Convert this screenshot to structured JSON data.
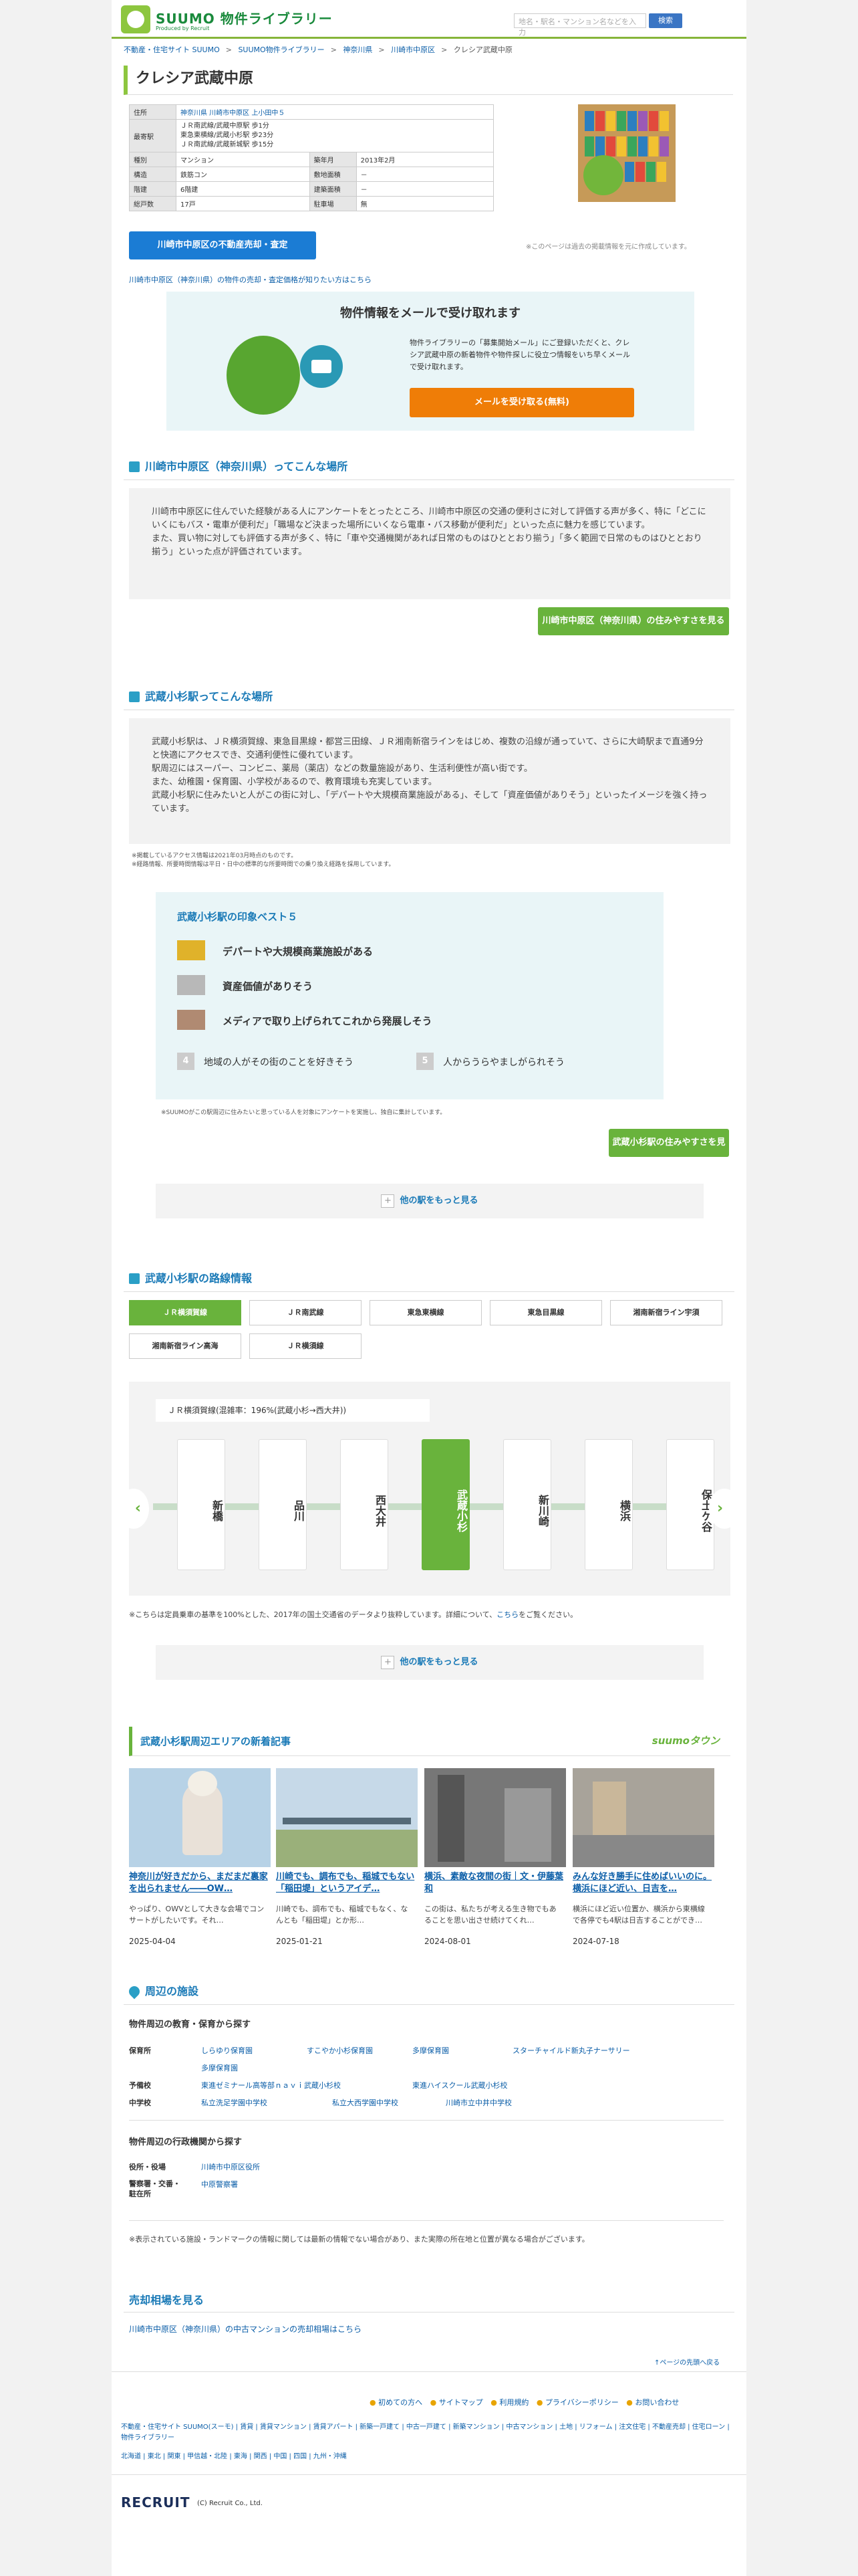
{
  "header": {
    "site_name": "SUUMO 物件ライブラリー",
    "logo_sub": "Produced by Recruit",
    "search_placeholder": "地名・駅名・マンション名などを入力",
    "search_button": "検索"
  },
  "breadcrumb": [
    "不動産・住宅サイト SUUMO",
    "SUUMO物件ライブラリー",
    "神奈川県",
    "川崎市中原区",
    "クレシア武蔵中原"
  ],
  "property": {
    "name": "クレシア武蔵中原",
    "rows": [
      {
        "label": "住所",
        "value": "神奈川県 川崎市中原区 上小田中５",
        "link": true
      },
      {
        "label": "最寄駅",
        "value": "ＪＲ南武線/武蔵中原駅 歩1分\n東急東横線/武蔵小杉駅 歩23分\nＪＲ南武線/武蔵新城駅 歩15分"
      }
    ],
    "grid": [
      [
        "種別",
        "マンション",
        "築年月",
        "2013年2月"
      ],
      [
        "構造",
        "鉄筋コン",
        "敷地面積",
        "－"
      ],
      [
        "階建",
        "6階建",
        "建築面積",
        "－"
      ],
      [
        "総戸数",
        "17戸",
        "駐車場",
        "無"
      ]
    ],
    "sell_button": "川崎市中原区の不動産売却・査定",
    "note_right": "※このページは過去の掲載情報を元に作成しています。",
    "price_link": "川崎市中原区（神奈川県）の物件の売却・査定価格が知りたい方はこちら"
  },
  "mail": {
    "title": "物件情報をメールで受け取れます",
    "text": "物件ライブラリーの「募集開始メール」にご登録いただくと、クレシア武蔵中原の新着物件や物件探しに役立つ情報をいち早くメールで受け取れます。",
    "button": "メールを受け取る(無料)"
  },
  "area_section": {
    "heading": "川崎市中原区（神奈川県）ってこんな場所",
    "paragraphs": [
      "川崎市中原区に住んでいた経験がある人にアンケートをとったところ、川崎市中原区の交通の便利さに対して評価する声が多く、特に「どこにいくにもバス・電車が便利だ」「職場など決まった場所にいくなら電車・バス移動が便利だ」といった点に魅力を感じています。",
      "また、買い物に対しても評価する声が多く、特に「車や交通機関があれば日常のものはひととおり揃う」「多く範囲で日常のものはひととおり揃う」といった点が評価されています。"
    ],
    "button": "川崎市中原区（神奈川県）の住みやすさを見る"
  },
  "station_section": {
    "heading": "武蔵小杉駅ってこんな場所",
    "paragraphs": [
      "武蔵小杉駅は、ＪＲ横須賀線、東急目黒線・都営三田線、ＪＲ湘南新宿ラインをはじめ、複数の沿線が通っていて、さらに大崎駅まで直通9分と快適にアクセスでき、交通利便性に優れています。",
      "駅周辺にはスーパー、コンビニ、薬局（薬店）などの数量施設があり、生活利便性が高い街です。",
      "また、幼稚園・保育園、小学校があるので、教育環境も充実しています。",
      "武蔵小杉駅に住みたいと人がこの街に対し、「デパートや大規模商業施設がある」、そして「資産価値がありそう」といったイメージを強く持っています。"
    ],
    "notes": [
      "※掲載しているアクセス情報は2021年03月時点のものです。",
      "※経路情報、所要時間情報は平日・日中の標準的な所要時間での乗り換え経路を採用しています。"
    ],
    "ranking_title": "武蔵小杉駅の印象ベスト５",
    "ranking": [
      {
        "rank": "1",
        "label": "デパートや大規模商業施設がある"
      },
      {
        "rank": "2",
        "label": "資産価値がありそう"
      },
      {
        "rank": "3",
        "label": "メディアで取り上げられてこれから発展しそう"
      },
      {
        "rank": "4",
        "label": "地域の人がその街のことを好きそう"
      },
      {
        "rank": "5",
        "label": "人からうらやましがられそう"
      }
    ],
    "ranking_note": "※SUUMOがこの駅周辺に住みたいと思っている人を対象にアンケートを実施し、独自に集計しています。",
    "button": "武蔵小杉駅の住みやすさを見る",
    "more": "他の駅をもっと見る"
  },
  "lines_section": {
    "heading": "武蔵小杉駅の路線情報",
    "tabs": [
      "ＪＲ横須賀線",
      "ＪＲ南武線",
      "東急東横線",
      "東急目黒線",
      "湘南新宿ライン宇須",
      "湘南新宿ライン高海",
      "ＪＲ横須線"
    ],
    "line_label": "ＪＲ横須賀線(混雑率：196%(武蔵小杉→西大井))",
    "stations": [
      "新橋",
      "品川",
      "西大井",
      "武蔵小杉",
      "新川崎",
      "横浜",
      "保土ケ谷"
    ],
    "active_station": "武蔵小杉",
    "note_prefix": "※こちらは定員乗車の基準を100%とした、2017年の国土交通省のデータより抜粋しています。詳細について、",
    "note_link": "こちら",
    "note_suffix": "をご覧ください。",
    "more": "他の駅をもっと見る"
  },
  "articles_section": {
    "heading": "武蔵小杉駅周辺エリアの新着記事",
    "brand": "suumoタウン",
    "articles": [
      {
        "title": "神奈川が好きだから、まだまだ裏家を出られません――OW…",
        "desc": "やっぱり、OWVとして大きな会場でコンサートがしたいです。それ…",
        "date": "2025-04-04"
      },
      {
        "title": "川崎でも、調布でも、稲城でもない「稲田堤」というアイデ…",
        "desc": "川崎でも、調布でも、稲城でもなく、なんとも「稲田堤」とか形…",
        "date": "2025-01-21"
      },
      {
        "title": "横浜、素敵な夜間の街｜文・伊藤葉和",
        "desc": "この街は、私たちが考える生き物でもあることを思い出させ続けてくれ…",
        "date": "2024-08-01"
      },
      {
        "title": "みんな好き勝手に住めばいいのに。横浜にほど近い、日吉を…",
        "desc": "横浜にほど近い位置か、横浜から東横線で各停でも4駅は日吉することができ…",
        "date": "2024-07-18"
      }
    ]
  },
  "facility_section": {
    "heading": "周辺の施設",
    "edu_title": "物件周辺の教育・保育から探す",
    "edu_rows": [
      {
        "label": "保育所",
        "links": [
          "しらゆり保育園",
          "すこやか小杉保育園",
          "多摩保育園",
          "スターチャイルド新丸子ナーサリー"
        ]
      },
      {
        "label": "",
        "links": [
          "多摩保育園"
        ]
      },
      {
        "label": "予備校",
        "links": [
          "東進ゼミナール高等部ｎａｖｉ武蔵小杉校",
          "東進ハイスクール武蔵小杉校"
        ]
      },
      {
        "label": "中学校",
        "links": [
          "私立洗足学園中学校",
          "私立大西学園中学校",
          "川崎市立中井中学校"
        ]
      }
    ],
    "gov_title": "物件周辺の行政機関から探す",
    "gov_rows": [
      {
        "label": "役所・役場",
        "links": [
          "川崎市中原区役所"
        ]
      },
      {
        "label": "警察署・交番・駐在所",
        "links": [
          "中原警察署"
        ]
      }
    ],
    "note": "※表示されている施設・ランドマークの情報に関しては最新の情報でない場合があり、また実際の所在地と位置が異なる場合がございます。"
  },
  "sales_section": {
    "heading": "売却相場を見る",
    "link": "川崎市中原区（神奈川県）の中古マンションの売却相場はこちら"
  },
  "footer": {
    "pagetop": "↑ページの先頭へ戻る",
    "nav": [
      "初めての方へ",
      "サイトマップ",
      "利用規約",
      "プライバシーポリシー",
      "お問い合わせ"
    ],
    "links_1": "不動産・住宅サイト SUUMO(スーモ) | 賃貸 | 賃貸マンション | 賃貸アパート | 新築一戸建て | 中古一戸建て | 新築マンション | 中古マンション | 土地 | リフォーム | 注文住宅 | 不動産売却 | 住宅ローン | 物件ライブラリー",
    "links_2": "北海道 | 東北 | 関東 | 甲信越・北陸 | 東海 | 関西 | 中国 | 四国 | 九州・沖縄",
    "company": "RECRUIT",
    "copyright": "(C) Recruit Co., Ltd."
  }
}
